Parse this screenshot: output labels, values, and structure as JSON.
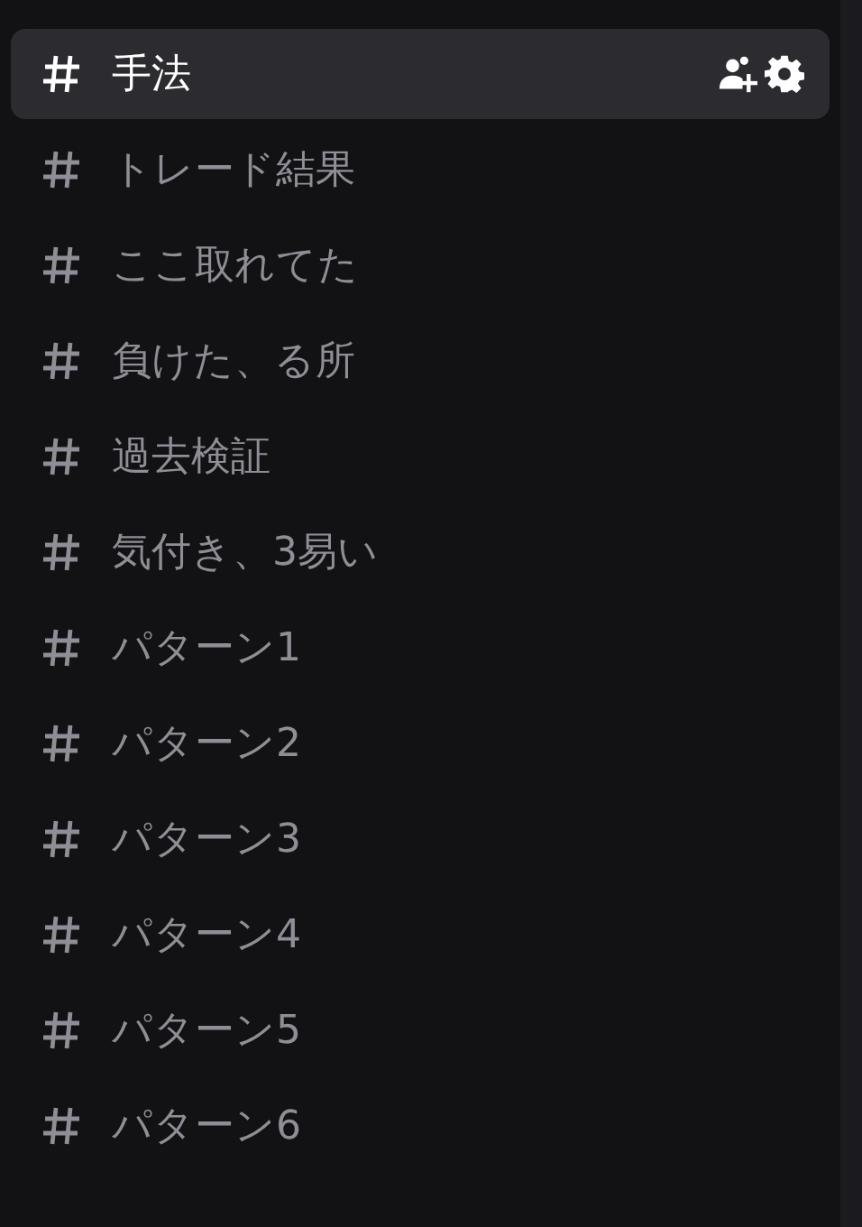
{
  "channels": [
    {
      "name": "手法",
      "selected": true
    },
    {
      "name": "トレード結果",
      "selected": false
    },
    {
      "name": "ここ取れてた",
      "selected": false
    },
    {
      "name": "負けた、る所",
      "selected": false
    },
    {
      "name": "過去検証",
      "selected": false
    },
    {
      "name": "気付き、3易い",
      "selected": false
    },
    {
      "name": "パターン1",
      "selected": false
    },
    {
      "name": "パターン2",
      "selected": false
    },
    {
      "name": "パターン3",
      "selected": false
    },
    {
      "name": "パターン4",
      "selected": false
    },
    {
      "name": "パターン5",
      "selected": false
    },
    {
      "name": "パターン6",
      "selected": false
    }
  ]
}
